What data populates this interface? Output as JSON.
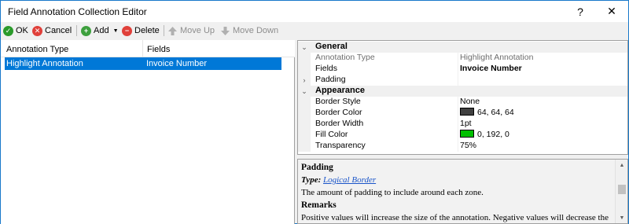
{
  "window": {
    "title": "Field Annotation Collection Editor",
    "help_label": "?",
    "close_label": "✕"
  },
  "toolbar": {
    "ok_label": "OK",
    "cancel_label": "Cancel",
    "add_label": "Add",
    "delete_label": "Delete",
    "move_up_label": "Move Up",
    "move_down_label": "Move Down"
  },
  "list": {
    "columns": [
      "Annotation Type",
      "Fields"
    ],
    "rows": [
      {
        "type": "Highlight Annotation",
        "fields": "Invoice Number"
      }
    ]
  },
  "property_grid": {
    "general_label": "General",
    "appearance_label": "Appearance",
    "general": [
      {
        "name": "Annotation Type",
        "value": "Highlight Annotation"
      },
      {
        "name": "Fields",
        "value": "Invoice Number"
      },
      {
        "name": "Padding",
        "value": ""
      }
    ],
    "appearance": [
      {
        "name": "Border Style",
        "value": "None"
      },
      {
        "name": "Border Color",
        "value": "64, 64, 64",
        "swatch": "#404040"
      },
      {
        "name": "Border Width",
        "value": "1pt"
      },
      {
        "name": "Fill Color",
        "value": "0, 192, 0",
        "swatch": "#00c000"
      },
      {
        "name": "Transparency",
        "value": "75%"
      }
    ]
  },
  "help": {
    "title": "Padding",
    "type_prefix": "Type:",
    "type_link": "Logical Border",
    "description": "The amount of padding to include around each zone.",
    "remarks_title": "Remarks",
    "remarks_text": "Positive values will increase the size of the annotation. Negative values will decrease the"
  },
  "colors": {
    "accent": "#0078d7",
    "ok_green": "#2a9a2a",
    "cancel_red": "#e0403a",
    "add_green": "#3ea03e",
    "delete_red": "#e0403a"
  }
}
